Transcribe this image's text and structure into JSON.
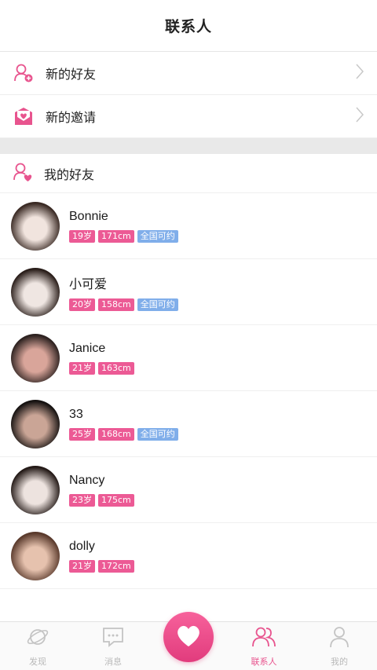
{
  "header": {
    "title": "联系人"
  },
  "menu": {
    "new_friends": "新的好友",
    "new_invites": "新的邀请"
  },
  "section": {
    "my_friends": "我的好友"
  },
  "contacts": [
    {
      "name": "Bonnie",
      "tags": [
        "19岁",
        "171cm",
        "全国可约"
      ],
      "avatar_colors": [
        "#f1e4de",
        "#3a2a24"
      ]
    },
    {
      "name": "小可爱",
      "tags": [
        "20岁",
        "158cm",
        "全国可约"
      ],
      "avatar_colors": [
        "#efe6e2",
        "#2a1e1a"
      ]
    },
    {
      "name": "Janice",
      "tags": [
        "21岁",
        "163cm"
      ],
      "avatar_colors": [
        "#d9a59a",
        "#2d2220"
      ]
    },
    {
      "name": "33",
      "tags": [
        "25岁",
        "168cm",
        "全国可约"
      ],
      "avatar_colors": [
        "#caa596",
        "#161211"
      ]
    },
    {
      "name": "Nancy",
      "tags": [
        "23岁",
        "175cm"
      ],
      "avatar_colors": [
        "#ede3df",
        "#241a17"
      ]
    },
    {
      "name": "dolly",
      "tags": [
        "21岁",
        "172cm"
      ],
      "avatar_colors": [
        "#e6c2ae",
        "#5a3a2c"
      ]
    }
  ],
  "tabbar": {
    "discover": "发现",
    "messages": "消息",
    "contacts": "联系人",
    "me": "我的"
  },
  "colors": {
    "accent": "#e8548e",
    "tag_pink": "#ec5a95",
    "tag_blue": "#80aeea"
  }
}
